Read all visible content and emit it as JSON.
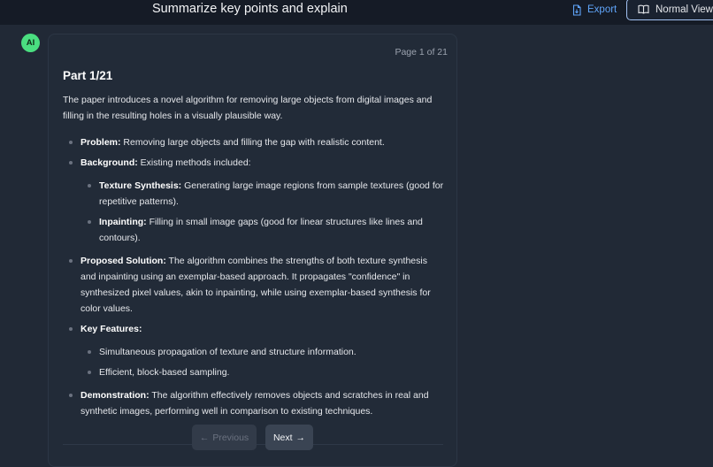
{
  "header": {
    "title": "Summarize key points and explain",
    "export_label": "Export",
    "normal_view_label": "Normal View"
  },
  "avatar": {
    "label": "AI",
    "color": "#4ade80"
  },
  "card": {
    "page_indicator": "Page 1 of 21",
    "part_title": "Part 1/21",
    "intro": "The paper introduces a novel algorithm for removing large objects from digital images and filling in the resulting holes in a visually plausible way.",
    "items": [
      {
        "label": "Problem:",
        "text": " Removing large objects and filling the gap with realistic content."
      },
      {
        "label": "Background:",
        "text": " Existing methods included:"
      },
      {
        "label": "Texture Synthesis:",
        "text": " Generating large image regions from sample textures (good for repetitive patterns)."
      },
      {
        "label": "Inpainting:",
        "text": " Filling in small image gaps (good for linear structures like lines and contours)."
      },
      {
        "label": "Proposed Solution:",
        "text": " The algorithm combines the strengths of both texture synthesis and inpainting using an exemplar-based approach. It propagates \"confidence\" in synthesized pixel values, akin to inpainting, while using exemplar-based synthesis for color values."
      },
      {
        "label": "Key Features:",
        "text": ""
      },
      {
        "label": "",
        "text": "Simultaneous propagation of texture and structure information."
      },
      {
        "label": "",
        "text": "Efficient, block-based sampling."
      },
      {
        "label": "Demonstration:",
        "text": " The algorithm effectively removes objects and scratches in real and synthetic images, performing well in comparison to existing techniques."
      }
    ]
  },
  "nav": {
    "previous_label": "Previous",
    "next_label": "Next"
  },
  "colors": {
    "background": "#212936",
    "accent": "#60a5fa"
  }
}
